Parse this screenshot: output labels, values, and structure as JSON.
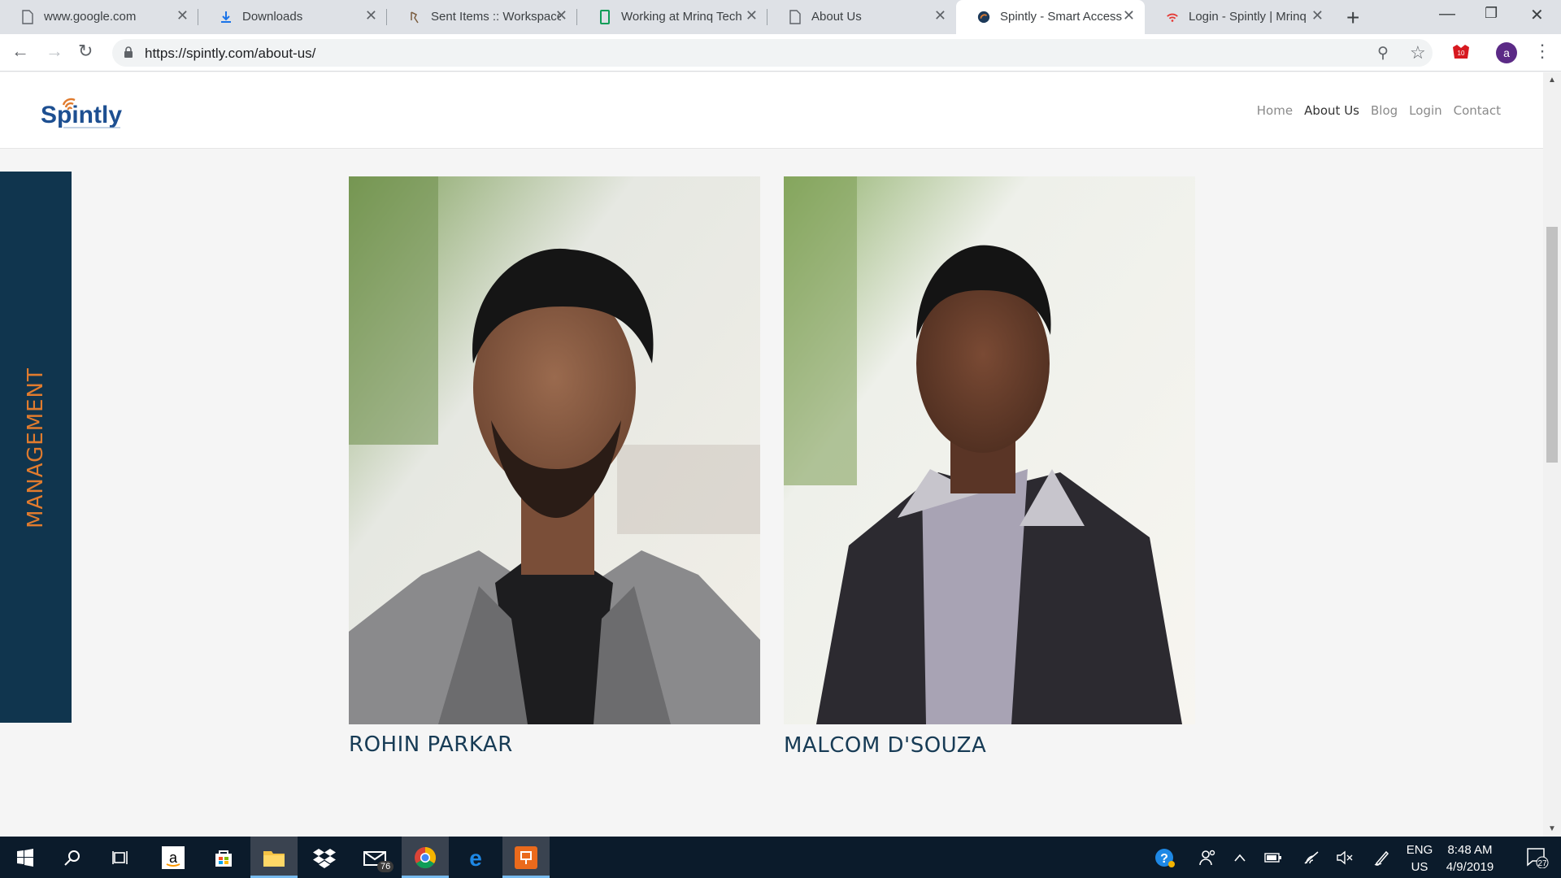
{
  "browser": {
    "tabs": [
      {
        "title": "www.google.com",
        "icon": "page-icon"
      },
      {
        "title": "Downloads",
        "icon": "download-icon"
      },
      {
        "title": "Sent Items :: Workspace",
        "icon": "mail-icon"
      },
      {
        "title": "Working at Mrinq Tech",
        "icon": "sheet-icon"
      },
      {
        "title": "About Us",
        "icon": "page-icon"
      },
      {
        "title": "Spintly - Smart Access",
        "icon": "spintly-icon"
      },
      {
        "title": "Login - Spintly | Mrinq",
        "icon": "wifi-icon"
      }
    ],
    "active_tab": 5,
    "url": "https://spintly.com/about-us/",
    "profile_initial": "a",
    "ext_badge": "10"
  },
  "site": {
    "nav": [
      {
        "label": "Home",
        "current": false
      },
      {
        "label": "About Us",
        "current": true
      },
      {
        "label": "Blog",
        "current": false
      },
      {
        "label": "Login",
        "current": false
      },
      {
        "label": "Contact",
        "current": false
      }
    ],
    "section_label": "MANAGEMENT",
    "members": [
      {
        "name": "ROHIN PARKAR"
      },
      {
        "name": "MALCOM D'SOUZA"
      }
    ],
    "colors": {
      "navy": "#10354e",
      "orange": "#e07b2e",
      "name": "#173b55"
    }
  },
  "taskbar": {
    "mail_badge": "76",
    "lang_top": "ENG",
    "lang_bottom": "US",
    "time": "8:48 AM",
    "date": "4/9/2019",
    "notif_count": "27"
  }
}
